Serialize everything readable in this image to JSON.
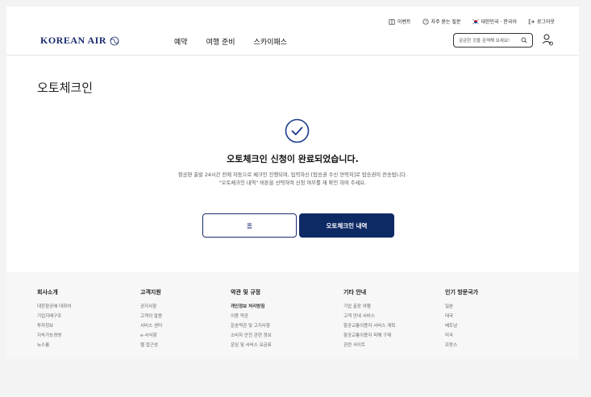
{
  "header": {
    "utility": [
      {
        "icon": "calendar-gift-icon",
        "label": "이벤트"
      },
      {
        "icon": "question-circle-icon",
        "label": "자주 묻는 질문"
      },
      {
        "icon": "korea-flag-icon",
        "label": "대한민국 · 한국어"
      },
      {
        "icon": "logout-icon",
        "label": "로그아웃"
      }
    ],
    "logo_text": "KOREAN AIR",
    "nav": [
      "예약",
      "여행 준비",
      "스카이패스"
    ],
    "search_placeholder": "궁금한 것을 검색해 보세요!",
    "accent_color": "#0e2a64"
  },
  "main": {
    "title": "오토체크인",
    "success_message": "오토체크인 신청이 완료되었습니다.",
    "description_line1": "항공편 출발 24시간 전에 자동으로 체크인 진행되며, 입력하신 [탑승권 수신 연락처]로 탑승권이 전송됩니다.",
    "description_line2": "\"오토체크인 내역\" 버튼을 선택하여 신청 여부를 재 확인 하여 주세요.",
    "home_button": "홈",
    "history_button": "오토체크인 내역"
  },
  "footer": {
    "columns": [
      {
        "title": "회사소개",
        "items": [
          "대한항공에 대하여",
          "기업지배구조",
          "투자정보",
          "지속가능경영",
          "뉴스룸"
        ]
      },
      {
        "title": "고객지원",
        "items": [
          "공지사항",
          "고객의 말씀",
          "서비스 센터",
          "e-서식함",
          "웹 접근성"
        ]
      },
      {
        "title": "약관 및 규정",
        "items": [
          "개인정보 처리방침",
          "이용 약관",
          "운송약관 및 고지사항",
          "소비자 안전 관련 정보",
          "운임 및 서비스 요금표"
        ]
      },
      {
        "title": "기타 안내",
        "items": [
          "기업 출장 여행",
          "고객 안내 서비스",
          "항공교통이용자 서비스 계획",
          "항공교통이용자 피해 구제",
          "관련 사이트"
        ]
      },
      {
        "title": "인기 방문국가",
        "items": [
          "일본",
          "태국",
          "베트남",
          "미국",
          "프랑스"
        ]
      }
    ]
  }
}
